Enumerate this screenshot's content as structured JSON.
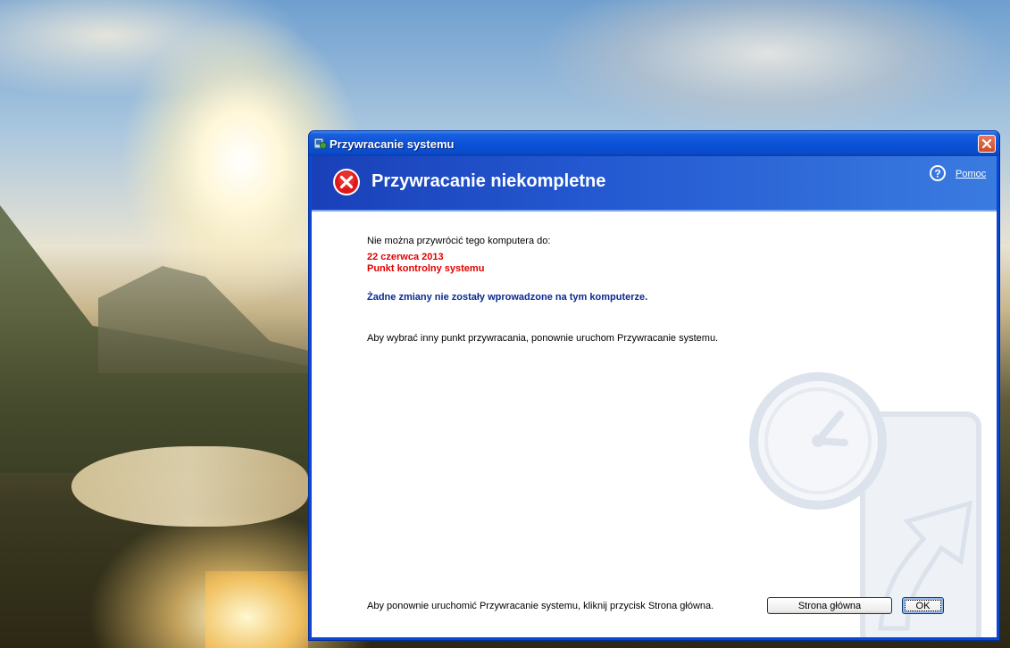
{
  "window": {
    "title": "Przywracanie systemu"
  },
  "header": {
    "title": "Przywracanie niekompletne",
    "help_label": "Pomoc"
  },
  "content": {
    "intro": "Nie można przywrócić tego komputera do:",
    "restore_date": "22 czerwca 2013",
    "restore_point": "Punkt kontrolny systemu",
    "no_changes": "Żadne zmiany nie zostały wprowadzone na tym komputerze.",
    "choose_other": "Aby wybrać inny punkt przywracania, ponownie uruchom Przywracanie systemu.",
    "restart_hint": "Aby ponownie uruchomić Przywracanie systemu, kliknij przycisk Strona główna."
  },
  "buttons": {
    "home_label": "Strona główna",
    "ok_label": "OK"
  },
  "colors": {
    "title_bar": "#0a52d8",
    "header_band": "#2358d0",
    "error_red": "#e00000",
    "message_blue": "#0a2a90"
  },
  "icons": {
    "app": "system-restore-icon",
    "close": "close-icon",
    "error": "error-icon",
    "help": "help-icon",
    "watermark": "clock-restore-icon"
  }
}
